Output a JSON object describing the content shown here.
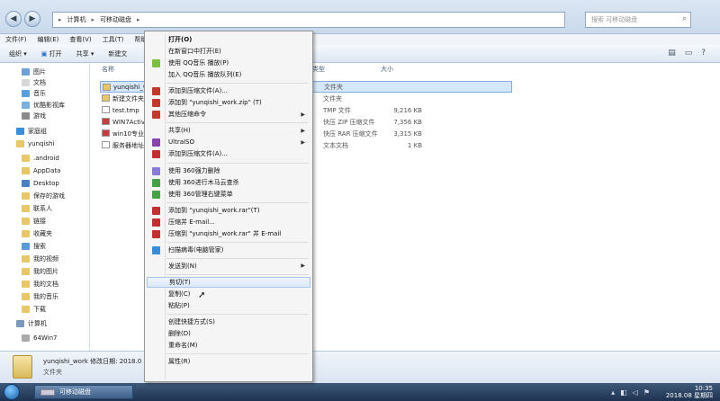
{
  "address": {
    "path1": "计算机",
    "path2": "可移动磁盘",
    "search_placeholder": "搜索 可移动磁盘"
  },
  "menubar": [
    "文件(F)",
    "编辑(E)",
    "查看(V)",
    "工具(T)",
    "帮助(H)"
  ],
  "toolbar": {
    "organize": "组织 ▾",
    "open": "打开",
    "share": "共享 ▾",
    "newfolder": "新建文"
  },
  "nav": [
    {
      "label": "图片",
      "color": "#6fa0d8"
    },
    {
      "label": "文档",
      "color": "#d8d8d8"
    },
    {
      "label": "音乐",
      "color": "#5aa0e0"
    },
    {
      "label": "优酷影视库",
      "color": "#7ab0e0"
    },
    {
      "label": "游戏",
      "color": "#8a8a8a"
    },
    {
      "label": "家庭组",
      "color": "#3b8fd8"
    },
    {
      "label": "yunqishi",
      "color": "#e8c66a"
    },
    {
      "label": ".android",
      "color": "#e8c66a"
    },
    {
      "label": "AppData",
      "color": "#e8c66a"
    },
    {
      "label": "Desktop",
      "color": "#4a7fc0"
    },
    {
      "label": "保存的游戏",
      "color": "#e8c66a"
    },
    {
      "label": "联系人",
      "color": "#e8c66a"
    },
    {
      "label": "链接",
      "color": "#e8c66a"
    },
    {
      "label": "收藏夹",
      "color": "#e8c66a"
    },
    {
      "label": "搜索",
      "color": "#5a9ad8"
    },
    {
      "label": "我的视频",
      "color": "#e8c66a"
    },
    {
      "label": "我的图片",
      "color": "#e8c66a"
    },
    {
      "label": "我的文档",
      "color": "#e8c66a"
    },
    {
      "label": "我的音乐",
      "color": "#e8c66a"
    },
    {
      "label": "下载",
      "color": "#e8c66a"
    },
    {
      "label": "计算机",
      "color": "#7a9ac0"
    },
    {
      "label": "64Win7",
      "color": "#aaaaaa"
    }
  ],
  "files_header": {
    "name": "名称",
    "type": "类型",
    "size": "大小"
  },
  "files": [
    {
      "name": "yunqishi_wo",
      "type": "文件夹",
      "size": "",
      "color": "#e8c66a"
    },
    {
      "name": "新建文件夹",
      "type": "文件夹",
      "size": "",
      "color": "#e8c66a"
    },
    {
      "name": "test.tmp",
      "type": "TMP 文件",
      "size": "9,216 KB",
      "color": "#ffffff"
    },
    {
      "name": "WIN7Activ",
      "type": "快压 ZIP 压缩文件",
      "size": "7,356 KB",
      "color": "#c04040"
    },
    {
      "name": "win10专业",
      "type": "快压 RAR 压缩文件",
      "size": "3,315 KB",
      "color": "#c04040"
    },
    {
      "name": "服务器地址",
      "type": "文本文档",
      "size": "1 KB",
      "color": "#ffffff"
    }
  ],
  "status": {
    "name": "yunqishi_work",
    "detail": "修改日期: 2018.0",
    "kind": "文件夹"
  },
  "taskbar": {
    "app": "可移动磁盘",
    "time": "10:35",
    "date": "2018.08 星期四"
  },
  "menu": [
    {
      "label": "打开(O)",
      "bold": true,
      "icon": ""
    },
    {
      "label": "在新窗口中打开(E)",
      "icon": ""
    },
    {
      "label": "使用 QQ音乐 播放(P)",
      "icon": "#7cc043"
    },
    {
      "label": "加入 QQ音乐 播放队列(E)",
      "icon": ""
    },
    {
      "sep": true
    },
    {
      "label": "添加到压缩文件(A)...",
      "icon": "#c0392b"
    },
    {
      "label": "添加到 \"yunqishi_work.zip\" (T)",
      "icon": "#c0392b"
    },
    {
      "label": "其他压缩命令",
      "icon": "#c0392b",
      "arrow": true
    },
    {
      "sep": true
    },
    {
      "label": "共享(H)",
      "icon": "",
      "arrow": true
    },
    {
      "label": "UltraISO",
      "icon": "#8844aa",
      "arrow": true
    },
    {
      "label": "添加到压缩文件(A)...",
      "icon": "#c03030"
    },
    {
      "sep": true
    },
    {
      "label": "使用 360强力删除",
      "icon": "#8a7ad8"
    },
    {
      "label": "使用 360进行木马云查杀",
      "icon": "#46a046"
    },
    {
      "label": "使用 360管理右键菜单",
      "icon": "#46a046"
    },
    {
      "sep": true
    },
    {
      "label": "添加到 \"yunqishi_work.rar\"(T)",
      "icon": "#c03030"
    },
    {
      "label": "压缩并 E-mail...",
      "icon": "#c03030"
    },
    {
      "label": "压缩到 \"yunqishi_work.rar\" 并 E-mail",
      "icon": "#c03030"
    },
    {
      "sep": true
    },
    {
      "label": "扫描病毒(电脑管家)",
      "icon": "#3a8ad8"
    },
    {
      "sep": true
    },
    {
      "label": "发送到(N)",
      "icon": "",
      "arrow": true
    },
    {
      "sep": true
    },
    {
      "label": "剪切(T)",
      "icon": "",
      "highlight": true
    },
    {
      "label": "复制(C)",
      "icon": ""
    },
    {
      "label": "粘贴(P)",
      "icon": ""
    },
    {
      "sep": true
    },
    {
      "label": "创建快捷方式(S)",
      "icon": ""
    },
    {
      "label": "删除(D)",
      "icon": ""
    },
    {
      "label": "重命名(M)",
      "icon": ""
    },
    {
      "sep": true
    },
    {
      "label": "属性(R)",
      "icon": ""
    }
  ]
}
